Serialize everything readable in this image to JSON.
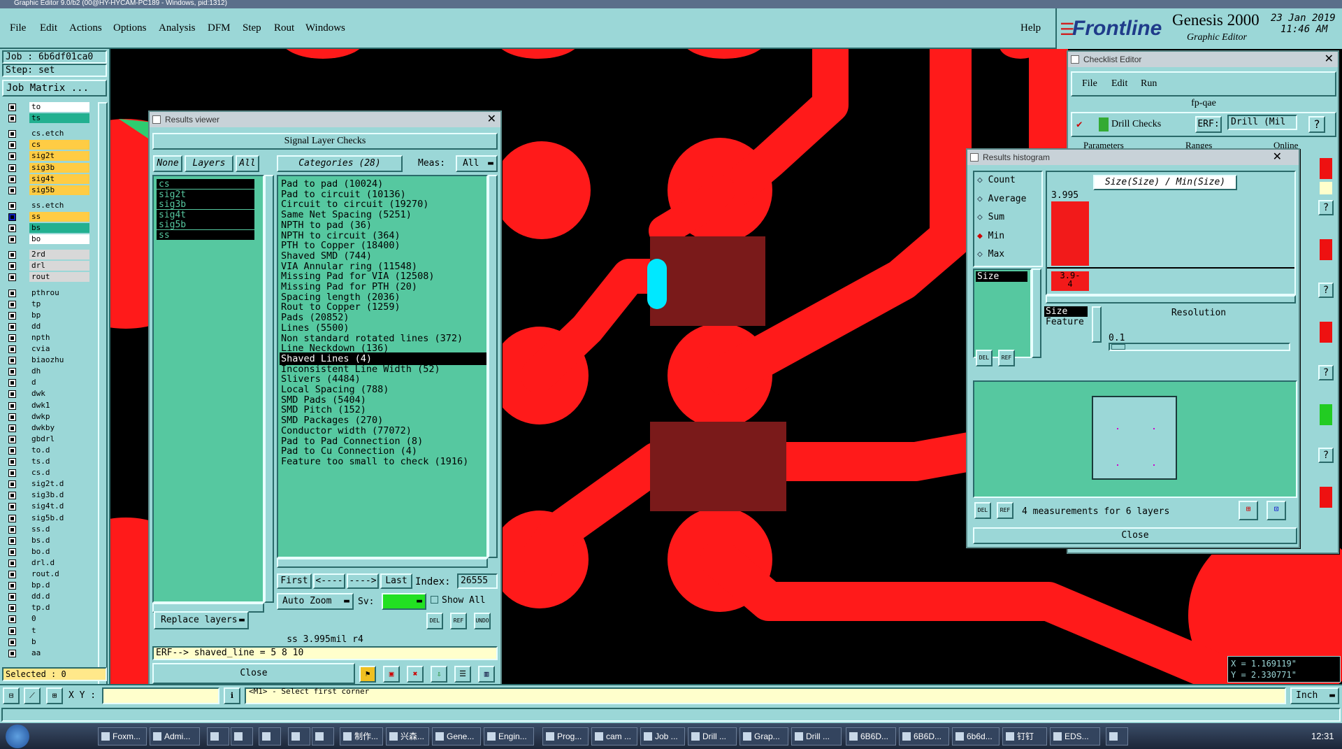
{
  "window_title": "Graphic Editor 9.0/b2 (00@HY-HYCAM-PC189 - Windows, pid:1312)",
  "menu": [
    "File",
    "Edit",
    "Actions",
    "Options",
    "Analysis",
    "DFM",
    "Step",
    "Rout",
    "Windows"
  ],
  "help": "Help",
  "brand": {
    "logo": "Frontline",
    "product": "Genesis 2000",
    "sub": "Graphic Editor",
    "date": "23 Jan 2019",
    "time": "11:46 AM"
  },
  "left": {
    "job": "Job : 6b6df01ca0",
    "step": "Step: set",
    "job_matrix": "Job Matrix ...",
    "layers": [
      {
        "n": "to",
        "c": "#ffffff"
      },
      {
        "n": "ts",
        "c": "#22b090"
      },
      {
        "n": "cs.etch",
        "c": "#9bd7d7"
      },
      {
        "n": "cs",
        "c": "#ffcc44"
      },
      {
        "n": "sig2t",
        "c": "#ffcc44"
      },
      {
        "n": "sig3b",
        "c": "#ffcc44"
      },
      {
        "n": "sig4t",
        "c": "#ffcc44"
      },
      {
        "n": "sig5b",
        "c": "#ffcc44"
      },
      {
        "n": "ss.etch",
        "c": "#9bd7d7"
      },
      {
        "n": "ss",
        "c": "#ffcc44"
      },
      {
        "n": "bs",
        "c": "#22b090"
      },
      {
        "n": "bo",
        "c": "#ffffff"
      },
      {
        "n": "2rd",
        "c": "#d8d8d8"
      },
      {
        "n": "drl",
        "c": "#d8d8d8"
      },
      {
        "n": "rout",
        "c": "#d8d8d8"
      },
      {
        "n": "pthrou",
        "c": "#9bd7d7"
      },
      {
        "n": "tp",
        "c": "#9bd7d7"
      },
      {
        "n": "bp",
        "c": "#9bd7d7"
      },
      {
        "n": "dd",
        "c": "#9bd7d7"
      },
      {
        "n": "npth",
        "c": "#9bd7d7"
      },
      {
        "n": "cvia",
        "c": "#9bd7d7"
      },
      {
        "n": "biaozhu",
        "c": "#9bd7d7"
      },
      {
        "n": "dh",
        "c": "#9bd7d7"
      },
      {
        "n": "d",
        "c": "#9bd7d7"
      },
      {
        "n": "dwk",
        "c": "#9bd7d7"
      },
      {
        "n": "dwk1",
        "c": "#9bd7d7"
      },
      {
        "n": "dwkp",
        "c": "#9bd7d7"
      },
      {
        "n": "dwkby",
        "c": "#9bd7d7"
      },
      {
        "n": "gbdrl",
        "c": "#9bd7d7"
      },
      {
        "n": "to.d",
        "c": "#9bd7d7"
      },
      {
        "n": "ts.d",
        "c": "#9bd7d7"
      },
      {
        "n": "cs.d",
        "c": "#9bd7d7"
      },
      {
        "n": "sig2t.d",
        "c": "#9bd7d7"
      },
      {
        "n": "sig3b.d",
        "c": "#9bd7d7"
      },
      {
        "n": "sig4t.d",
        "c": "#9bd7d7"
      },
      {
        "n": "sig5b.d",
        "c": "#9bd7d7"
      },
      {
        "n": "ss.d",
        "c": "#9bd7d7"
      },
      {
        "n": "bs.d",
        "c": "#9bd7d7"
      },
      {
        "n": "bo.d",
        "c": "#9bd7d7"
      },
      {
        "n": "drl.d",
        "c": "#9bd7d7"
      },
      {
        "n": "rout.d",
        "c": "#9bd7d7"
      },
      {
        "n": "bp.d",
        "c": "#9bd7d7"
      },
      {
        "n": "dd.d",
        "c": "#9bd7d7"
      },
      {
        "n": "tp.d",
        "c": "#9bd7d7"
      },
      {
        "n": "0",
        "c": "#9bd7d7"
      },
      {
        "n": "t",
        "c": "#9bd7d7"
      },
      {
        "n": "b",
        "c": "#9bd7d7"
      },
      {
        "n": "aa",
        "c": "#9bd7d7"
      }
    ],
    "selected": "Selected : 0"
  },
  "results_viewer": {
    "title": "Results viewer",
    "header": "Signal Layer Checks",
    "none": "None",
    "layers_btn": "Layers",
    "all": "All",
    "categories_label": "Categories (28)",
    "meas_label": "Meas:",
    "meas_value": "All",
    "layers": [
      "cs",
      "sig2t",
      "sig3b",
      "sig4t",
      "sig5b",
      "ss"
    ],
    "categories": [
      "Pad to pad (10024)",
      "Pad to circuit (10136)",
      "Circuit to circuit (19270)",
      "Same Net Spacing (5251)",
      "NPTH to pad (36)",
      "NPTH to circuit (364)",
      "PTH to Copper (18400)",
      "Shaved SMD (744)",
      "VIA Annular ring (11548)",
      "Missing Pad for VIA (12508)",
      "Missing Pad for PTH (20)",
      "Spacing length (2036)",
      "Rout to Copper (1259)",
      "Pads (20852)",
      "Lines (5500)",
      "Non standard rotated lines (372)",
      "Line Neckdown (136)",
      "Shaved Lines (4)",
      "Inconsistent Line Width (52)",
      "Slivers (4484)",
      "Local Spacing (788)",
      "SMD Pads (5404)",
      "SMD Pitch (152)",
      "SMD Packages (270)",
      "Conductor width (77072)",
      "Pad to Pad Connection (8)",
      "Pad to Cu Connection (4)",
      "Feature too small to check (1916)"
    ],
    "selected_index": 17,
    "first": "First",
    "prev": "<----",
    "next": "---->",
    "last": "Last",
    "index_label": "Index:",
    "index_value": "26555",
    "auto_zoom": "Auto Zoom",
    "sv_label": "Sv:",
    "show_all": "Show All",
    "replace_layers": "Replace layers",
    "status": "ss 3.995mil   r4",
    "erf_line": "ERF--> shaved_line = 5 8 10",
    "close": "Close",
    "del": "DEL",
    "ref": "REF",
    "undo": "UNDO"
  },
  "checklist": {
    "title": "Checklist Editor",
    "menu": [
      "File",
      "Edit",
      "Run"
    ],
    "name": "fp-qae",
    "row_name": "Drill Checks",
    "erf": "ERF:",
    "erf_value": "Drill (Mil",
    "tabs": [
      "Parameters",
      "Ranges",
      "Online"
    ],
    "q": "?"
  },
  "histogram": {
    "title": "Results histogram",
    "options": [
      "Count",
      "Average",
      "Sum",
      "Min",
      "Max"
    ],
    "selected_option": "Min",
    "list_item": "Size",
    "formula": "Size(Size) / Min(Size)",
    "bar_value": "3.995",
    "bar_label": "3.9-\n4",
    "size_feature": [
      "Size",
      "Feature"
    ],
    "resolution_label": "Resolution",
    "resolution_value": "0.1",
    "measurements": "4 measurements for 6 layers",
    "close": "Close",
    "del": "DEL",
    "ref": "REF"
  },
  "coords": {
    "x": "X = 1.169119\"",
    "y": "Y = 2.330771\""
  },
  "bottom": {
    "xy_label": "X Y :",
    "prompt": "<M1> - Select first corner",
    "units": "Inch"
  },
  "taskbar": {
    "items": [
      "Foxm...",
      "Admi...",
      "",
      "",
      "",
      "",
      "",
      "制作...",
      "兴森...",
      "Gene...",
      "Engin...",
      "Prog...",
      "cam ...",
      "Job ...",
      "Drill ...",
      "Grap...",
      "Drill ...",
      "6B6D...",
      "6B6D...",
      "6b6d...",
      "钉钉",
      "EDS...",
      ""
    ],
    "time": "12:31"
  },
  "colors": {
    "copper": "#ff1a1a",
    "panel": "#9bd7d7",
    "list": "#56c8a0",
    "highlight": "#00e8ff"
  }
}
